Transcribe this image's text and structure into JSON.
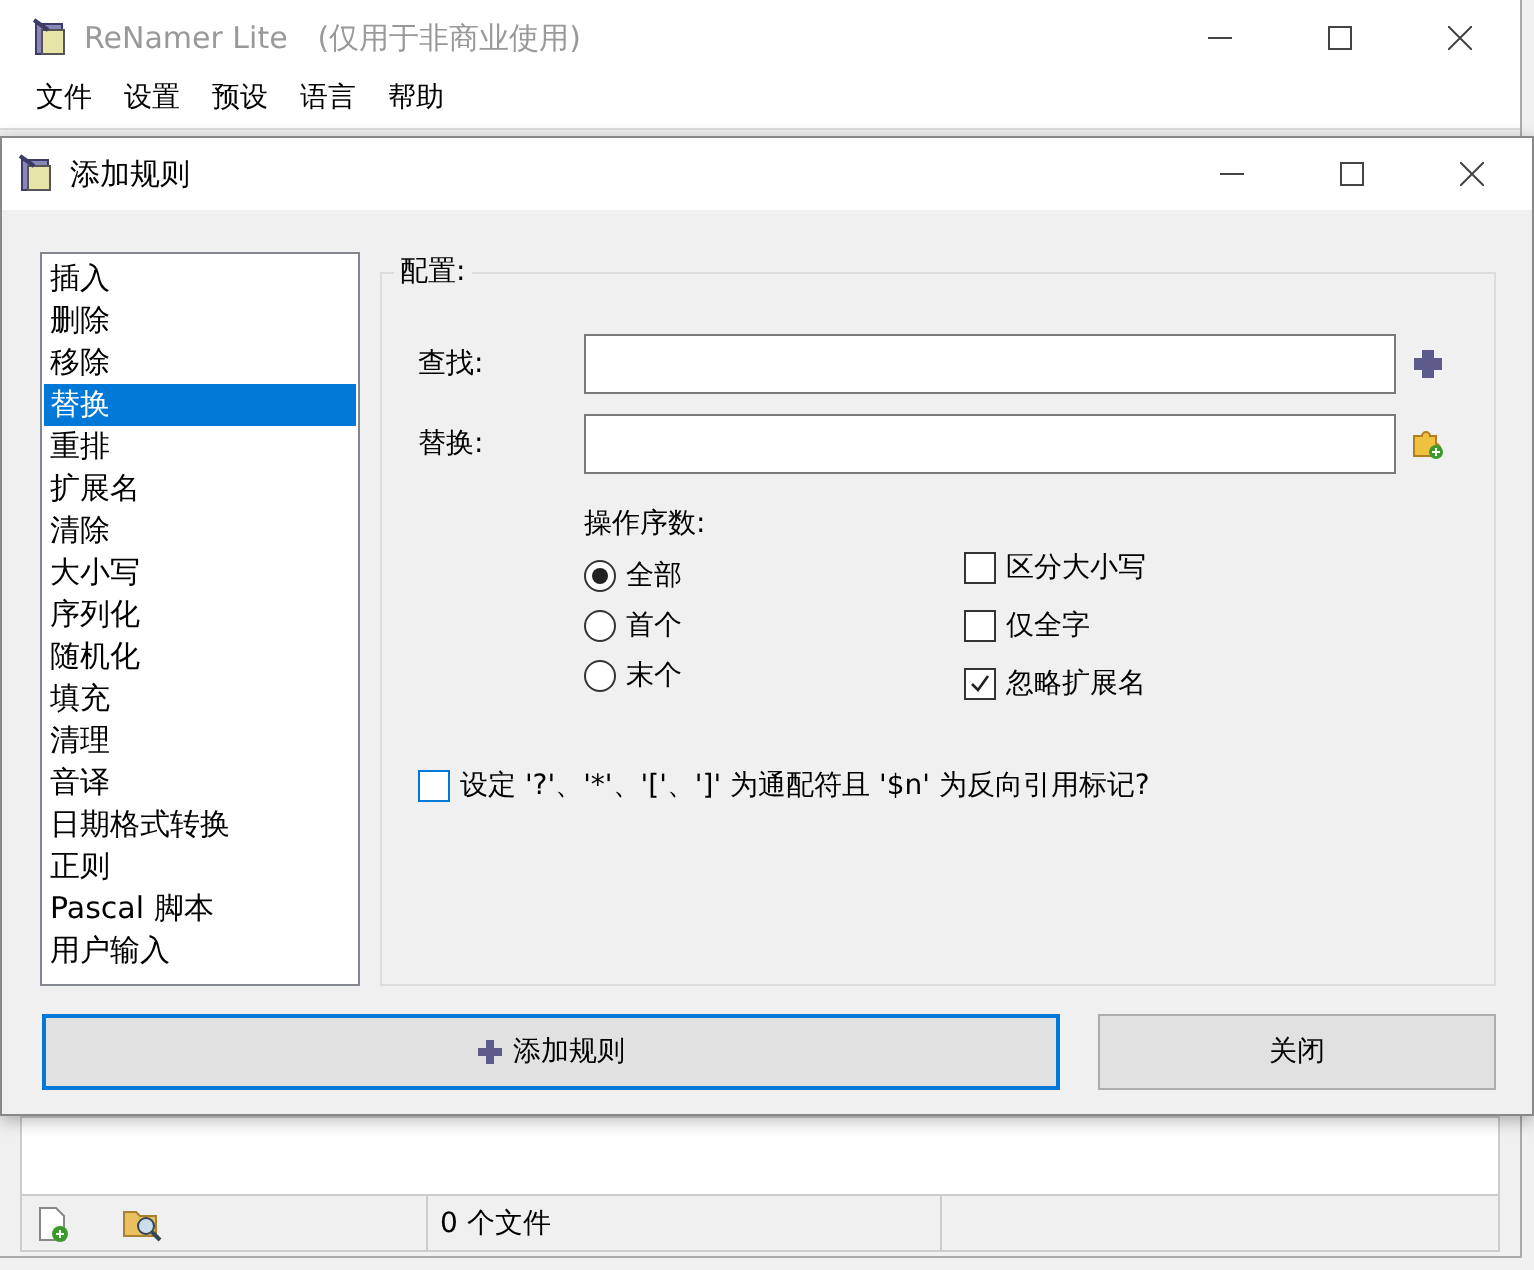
{
  "main_window": {
    "title": "ReNamer Lite　(仅用于非商业使用)",
    "menu": [
      {
        "label": "文件"
      },
      {
        "label": "设置"
      },
      {
        "label": "预设"
      },
      {
        "label": "语言"
      },
      {
        "label": "帮助"
      }
    ],
    "status_bar": {
      "file_count": "0 个文件"
    }
  },
  "dialog": {
    "title": "添加规则",
    "rules": [
      {
        "label": "插入",
        "selected": false
      },
      {
        "label": "删除",
        "selected": false
      },
      {
        "label": "移除",
        "selected": false
      },
      {
        "label": "替换",
        "selected": true
      },
      {
        "label": "重排",
        "selected": false
      },
      {
        "label": "扩展名",
        "selected": false
      },
      {
        "label": "清除",
        "selected": false
      },
      {
        "label": "大小写",
        "selected": false
      },
      {
        "label": "序列化",
        "selected": false
      },
      {
        "label": "随机化",
        "selected": false
      },
      {
        "label": "填充",
        "selected": false
      },
      {
        "label": "清理",
        "selected": false
      },
      {
        "label": "音译",
        "selected": false
      },
      {
        "label": "日期格式转换",
        "selected": false
      },
      {
        "label": "正则",
        "selected": false
      },
      {
        "label": "Pascal 脚本",
        "selected": false
      },
      {
        "label": "用户输入",
        "selected": false
      }
    ],
    "config": {
      "legend": "配置:",
      "fields": [
        {
          "label": "查找:",
          "kind": "plus"
        },
        {
          "label": "替换:",
          "kind": "puzzle"
        }
      ],
      "occurrence": {
        "label": "操作序数:",
        "options": [
          {
            "label": "全部",
            "selected": true
          },
          {
            "label": "首个",
            "selected": false
          },
          {
            "label": "末个",
            "selected": false
          }
        ]
      },
      "options": [
        {
          "label": "区分大小写",
          "checked": false
        },
        {
          "label": "仅全字",
          "checked": false
        },
        {
          "label": "忽略扩展名",
          "checked": true
        }
      ],
      "wildcard_option": {
        "label": "设定 '?'、'*'、'['、']' 为通配符且 '$n' 为反向引用标记?",
        "checked": false
      }
    },
    "buttons": [
      {
        "label": "添加规则",
        "kind": "add",
        "focused": true
      },
      {
        "label": "关闭",
        "kind": "plain",
        "focused": false
      }
    ]
  }
}
